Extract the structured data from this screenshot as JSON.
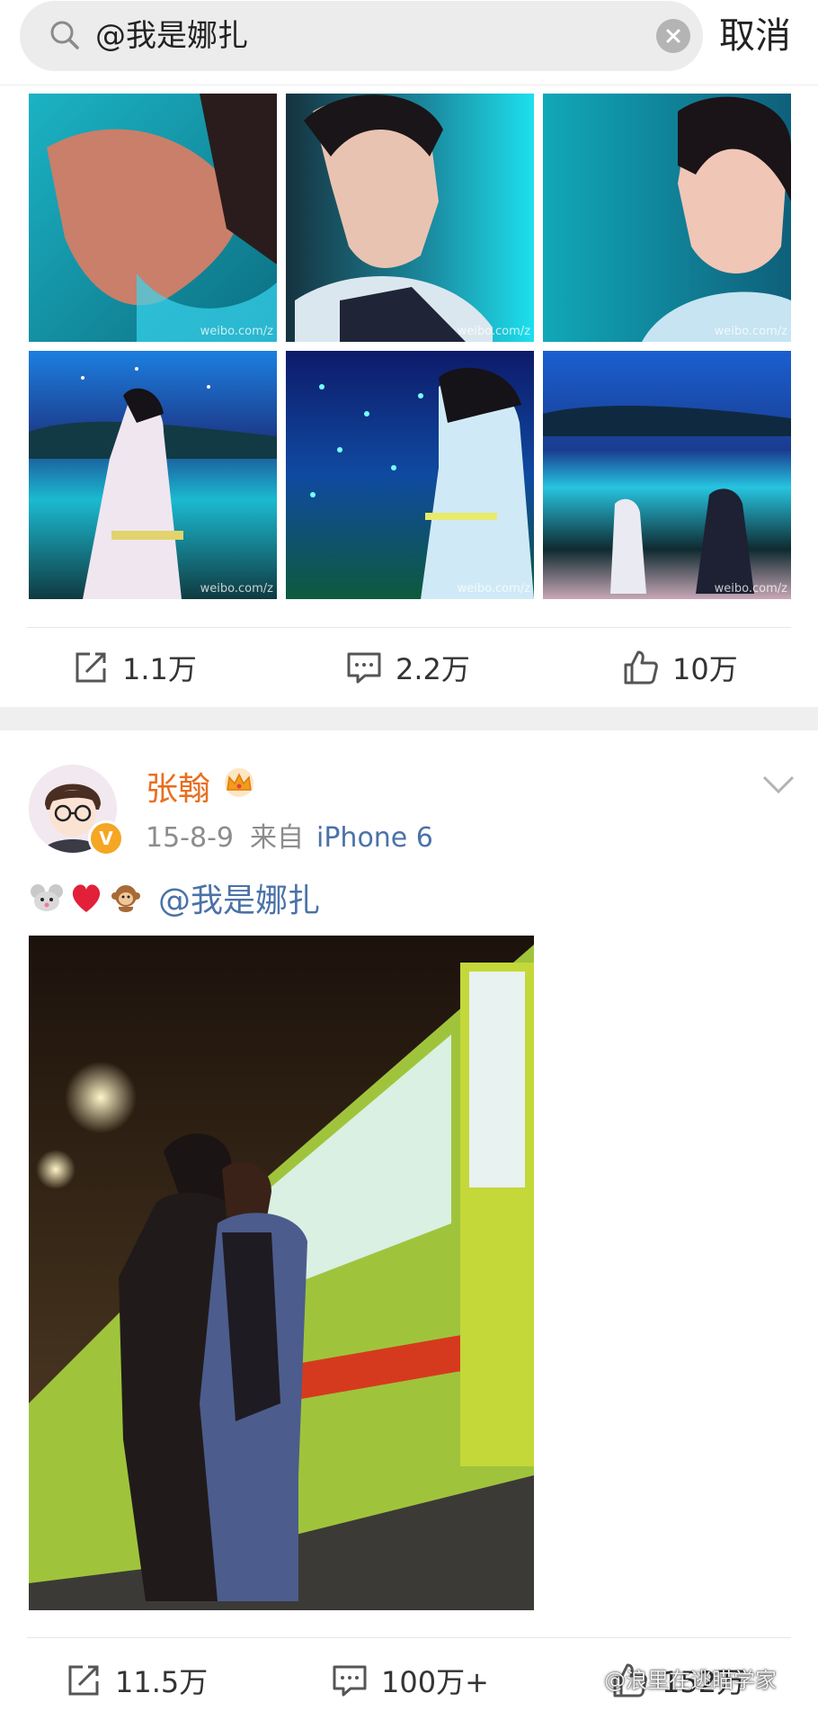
{
  "search": {
    "query": "@我是娜扎",
    "cancel_label": "取消"
  },
  "photo_watermark": "weibo.com/z",
  "first_post": {
    "actions": {
      "repost": "1.1万",
      "comment": "2.2万",
      "like": "10万"
    }
  },
  "second_post": {
    "username": "张翰",
    "verified_label": "V",
    "date": "15-8-9",
    "source_prefix": "来自",
    "device": "iPhone 6",
    "mention": "@我是娜扎",
    "emojis": [
      "mouse-emoji",
      "heart-emoji",
      "monkey-emoji"
    ],
    "actions": {
      "repost": "11.5万",
      "comment": "100万+",
      "like": "152万"
    }
  },
  "corner_watermark": "@浪里在逃瞄学家",
  "colors": {
    "username": "#e86f1f",
    "link": "#4b72a8",
    "meta": "#8c8c8c"
  }
}
